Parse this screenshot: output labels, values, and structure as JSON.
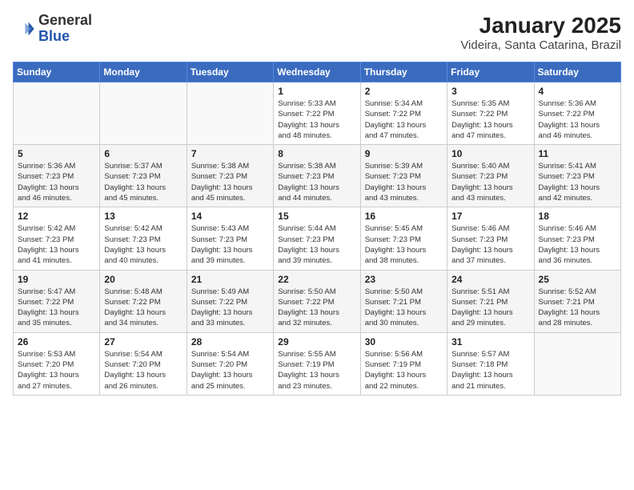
{
  "header": {
    "logo_line1": "General",
    "logo_line2": "Blue",
    "title": "January 2025",
    "subtitle": "Videira, Santa Catarina, Brazil"
  },
  "days_of_week": [
    "Sunday",
    "Monday",
    "Tuesday",
    "Wednesday",
    "Thursday",
    "Friday",
    "Saturday"
  ],
  "weeks": [
    [
      {
        "day": "",
        "info": ""
      },
      {
        "day": "",
        "info": ""
      },
      {
        "day": "",
        "info": ""
      },
      {
        "day": "1",
        "info": "Sunrise: 5:33 AM\nSunset: 7:22 PM\nDaylight: 13 hours\nand 48 minutes."
      },
      {
        "day": "2",
        "info": "Sunrise: 5:34 AM\nSunset: 7:22 PM\nDaylight: 13 hours\nand 47 minutes."
      },
      {
        "day": "3",
        "info": "Sunrise: 5:35 AM\nSunset: 7:22 PM\nDaylight: 13 hours\nand 47 minutes."
      },
      {
        "day": "4",
        "info": "Sunrise: 5:36 AM\nSunset: 7:22 PM\nDaylight: 13 hours\nand 46 minutes."
      }
    ],
    [
      {
        "day": "5",
        "info": "Sunrise: 5:36 AM\nSunset: 7:23 PM\nDaylight: 13 hours\nand 46 minutes."
      },
      {
        "day": "6",
        "info": "Sunrise: 5:37 AM\nSunset: 7:23 PM\nDaylight: 13 hours\nand 45 minutes."
      },
      {
        "day": "7",
        "info": "Sunrise: 5:38 AM\nSunset: 7:23 PM\nDaylight: 13 hours\nand 45 minutes."
      },
      {
        "day": "8",
        "info": "Sunrise: 5:38 AM\nSunset: 7:23 PM\nDaylight: 13 hours\nand 44 minutes."
      },
      {
        "day": "9",
        "info": "Sunrise: 5:39 AM\nSunset: 7:23 PM\nDaylight: 13 hours\nand 43 minutes."
      },
      {
        "day": "10",
        "info": "Sunrise: 5:40 AM\nSunset: 7:23 PM\nDaylight: 13 hours\nand 43 minutes."
      },
      {
        "day": "11",
        "info": "Sunrise: 5:41 AM\nSunset: 7:23 PM\nDaylight: 13 hours\nand 42 minutes."
      }
    ],
    [
      {
        "day": "12",
        "info": "Sunrise: 5:42 AM\nSunset: 7:23 PM\nDaylight: 13 hours\nand 41 minutes."
      },
      {
        "day": "13",
        "info": "Sunrise: 5:42 AM\nSunset: 7:23 PM\nDaylight: 13 hours\nand 40 minutes."
      },
      {
        "day": "14",
        "info": "Sunrise: 5:43 AM\nSunset: 7:23 PM\nDaylight: 13 hours\nand 39 minutes."
      },
      {
        "day": "15",
        "info": "Sunrise: 5:44 AM\nSunset: 7:23 PM\nDaylight: 13 hours\nand 39 minutes."
      },
      {
        "day": "16",
        "info": "Sunrise: 5:45 AM\nSunset: 7:23 PM\nDaylight: 13 hours\nand 38 minutes."
      },
      {
        "day": "17",
        "info": "Sunrise: 5:46 AM\nSunset: 7:23 PM\nDaylight: 13 hours\nand 37 minutes."
      },
      {
        "day": "18",
        "info": "Sunrise: 5:46 AM\nSunset: 7:23 PM\nDaylight: 13 hours\nand 36 minutes."
      }
    ],
    [
      {
        "day": "19",
        "info": "Sunrise: 5:47 AM\nSunset: 7:22 PM\nDaylight: 13 hours\nand 35 minutes."
      },
      {
        "day": "20",
        "info": "Sunrise: 5:48 AM\nSunset: 7:22 PM\nDaylight: 13 hours\nand 34 minutes."
      },
      {
        "day": "21",
        "info": "Sunrise: 5:49 AM\nSunset: 7:22 PM\nDaylight: 13 hours\nand 33 minutes."
      },
      {
        "day": "22",
        "info": "Sunrise: 5:50 AM\nSunset: 7:22 PM\nDaylight: 13 hours\nand 32 minutes."
      },
      {
        "day": "23",
        "info": "Sunrise: 5:50 AM\nSunset: 7:21 PM\nDaylight: 13 hours\nand 30 minutes."
      },
      {
        "day": "24",
        "info": "Sunrise: 5:51 AM\nSunset: 7:21 PM\nDaylight: 13 hours\nand 29 minutes."
      },
      {
        "day": "25",
        "info": "Sunrise: 5:52 AM\nSunset: 7:21 PM\nDaylight: 13 hours\nand 28 minutes."
      }
    ],
    [
      {
        "day": "26",
        "info": "Sunrise: 5:53 AM\nSunset: 7:20 PM\nDaylight: 13 hours\nand 27 minutes."
      },
      {
        "day": "27",
        "info": "Sunrise: 5:54 AM\nSunset: 7:20 PM\nDaylight: 13 hours\nand 26 minutes."
      },
      {
        "day": "28",
        "info": "Sunrise: 5:54 AM\nSunset: 7:20 PM\nDaylight: 13 hours\nand 25 minutes."
      },
      {
        "day": "29",
        "info": "Sunrise: 5:55 AM\nSunset: 7:19 PM\nDaylight: 13 hours\nand 23 minutes."
      },
      {
        "day": "30",
        "info": "Sunrise: 5:56 AM\nSunset: 7:19 PM\nDaylight: 13 hours\nand 22 minutes."
      },
      {
        "day": "31",
        "info": "Sunrise: 5:57 AM\nSunset: 7:18 PM\nDaylight: 13 hours\nand 21 minutes."
      },
      {
        "day": "",
        "info": ""
      }
    ]
  ]
}
